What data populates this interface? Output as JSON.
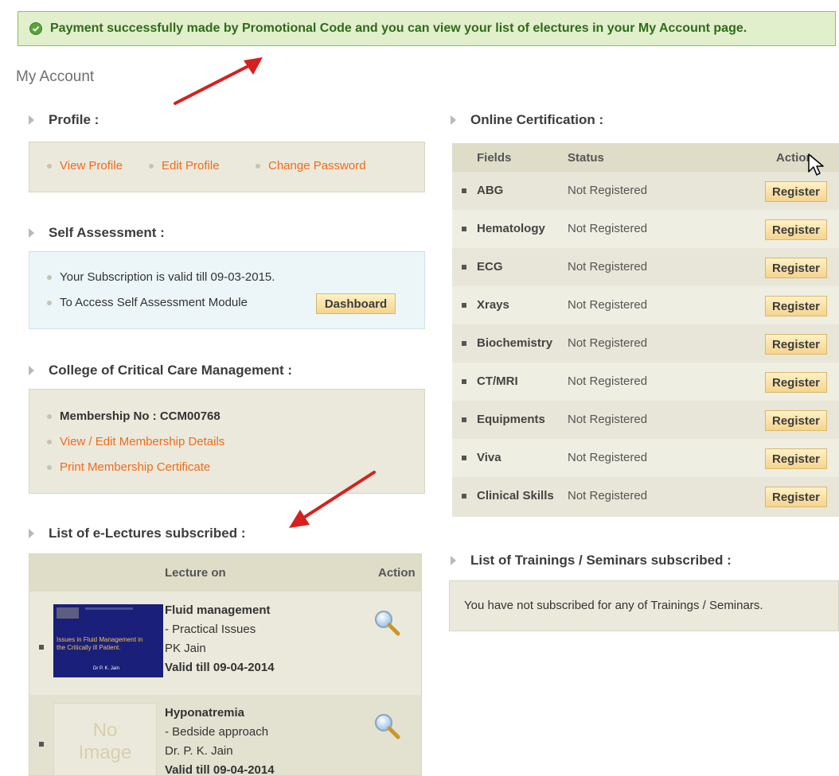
{
  "banner": {
    "message": "Payment successfully made by Promotional Code and you can view your list of electures in your My Account page."
  },
  "page_title": "My Account",
  "profile": {
    "title": "Profile :",
    "links": [
      "View Profile",
      "Edit Profile",
      "Change Password"
    ]
  },
  "self_assessment": {
    "title": "Self Assessment :",
    "line1": "Your Subscription is valid till 09-03-2015.",
    "line2": "To Access Self Assessment Module",
    "dashboard_label": "Dashboard"
  },
  "college": {
    "title": "College of Critical Care Management :",
    "membership": "Membership No : CCM00768",
    "link1": "View / Edit Membership Details",
    "link2": "Print Membership Certificate"
  },
  "lectures": {
    "title": "List of e-Lectures subscribed :",
    "col_lecture": "Lecture on",
    "col_action": "Action",
    "items": [
      {
        "title": "Fluid management",
        "subtitle": "- Practical Issues",
        "author": "PK Jain",
        "valid": "Valid till 09-04-2014",
        "thumb_line1": "Issues in Fluid Management in",
        "thumb_line2": "the Critically ill Patient.",
        "thumb_author": "Dr P. K. Jain"
      },
      {
        "title": "Hyponatremia",
        "subtitle": "- Bedside approach",
        "author": "Dr. P. K. Jain",
        "valid": "Valid till 09-04-2014",
        "thumb_no": "No",
        "thumb_image": "Image"
      }
    ]
  },
  "certification": {
    "title": "Online Certification :",
    "col_fields": "Fields",
    "col_status": "Status",
    "col_action": "Action",
    "register_label": "Register",
    "rows": [
      {
        "field": "ABG",
        "status": "Not Registered"
      },
      {
        "field": "Hematology",
        "status": "Not Registered"
      },
      {
        "field": "ECG",
        "status": "Not Registered"
      },
      {
        "field": "Xrays",
        "status": "Not Registered"
      },
      {
        "field": "Biochemistry",
        "status": "Not Registered"
      },
      {
        "field": "CT/MRI",
        "status": "Not Registered"
      },
      {
        "field": "Equipments",
        "status": "Not Registered"
      },
      {
        "field": "Viva",
        "status": "Not Registered"
      },
      {
        "field": "Clinical Skills",
        "status": "Not Registered"
      }
    ]
  },
  "trainings": {
    "title": "List of Trainings / Seminars subscribed :",
    "message": "You have not subscribed for any of Trainings / Seminars."
  },
  "icons": {
    "success": "check-circle-icon",
    "view": "magnifier-icon",
    "cursor": "mouse-pointer-icon",
    "annotation": "red-arrow"
  },
  "colors": {
    "link": "#f26a1b",
    "banner_bg": "#e2efcc",
    "banner_text": "#2f6b1a",
    "button_bg": "#f5d48e",
    "panel_bg": "#ebe9db"
  }
}
